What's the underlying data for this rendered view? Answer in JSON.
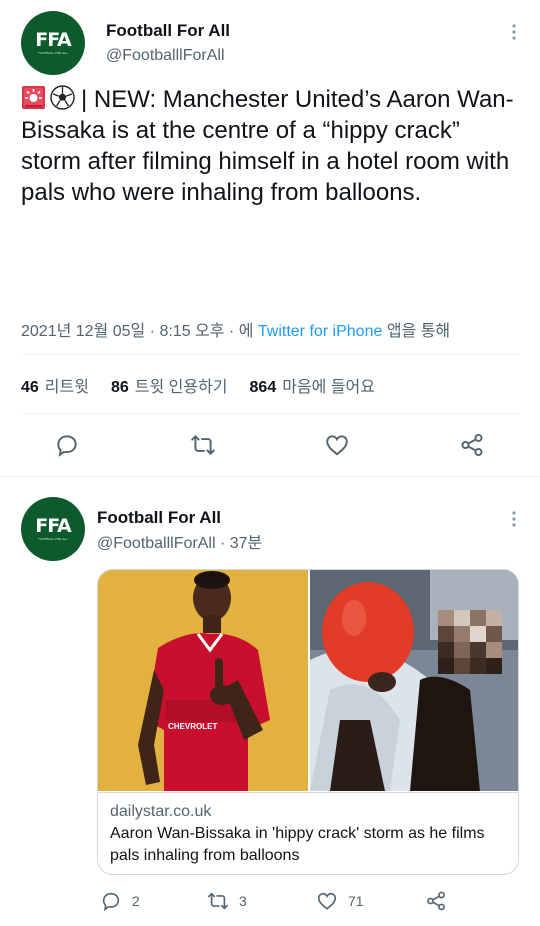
{
  "tweet": {
    "author_name": "Football For All",
    "author_handle": "@FootballlForAll",
    "avatar_text": "FFA",
    "avatar_subtext": "FOOTBALL FOR ALL",
    "text_emojis": "🚨⚽",
    "text": "| NEW: Manchester United’s Aaron Wan-Bissaka is at the centre of a “hippy crack” storm after filming himself in a hotel room with pals who were inhaling from balloons.",
    "timestamp": "2021년 12월 05일 · 8:15 오후 · 에",
    "source_link": "Twitter for iPhone",
    "source_suffix": "앱을 통해",
    "retweets_count": "46",
    "retweets_label": "리트윗",
    "quotes_count": "86",
    "quotes_label": "트윗 인용하기",
    "likes_count": "864",
    "likes_label": "마음에 들어요"
  },
  "reply": {
    "author_name": "Football For All",
    "author_handle": "@FootballlForAll",
    "time_ago": "· 37분",
    "avatar_text": "FFA",
    "avatar_subtext": "FOOTBALL FOR ALL",
    "card": {
      "domain": "dailystar.co.uk",
      "title": "Aaron Wan-Bissaka in 'hippy crack' storm as he films pals inhaling from balloons",
      "jersey_sponsor": "CHEVROLET"
    },
    "reply_count": "2",
    "retweet_count": "3",
    "like_count": "71"
  },
  "colors": {
    "accent": "#1d9bf0",
    "text_secondary": "#536471",
    "avatar_bg": "#0d5b2c"
  },
  "icons": [
    "more-icon",
    "reply-icon",
    "retweet-icon",
    "like-icon",
    "share-icon",
    "siren-emoji",
    "soccer-ball-emoji"
  ]
}
